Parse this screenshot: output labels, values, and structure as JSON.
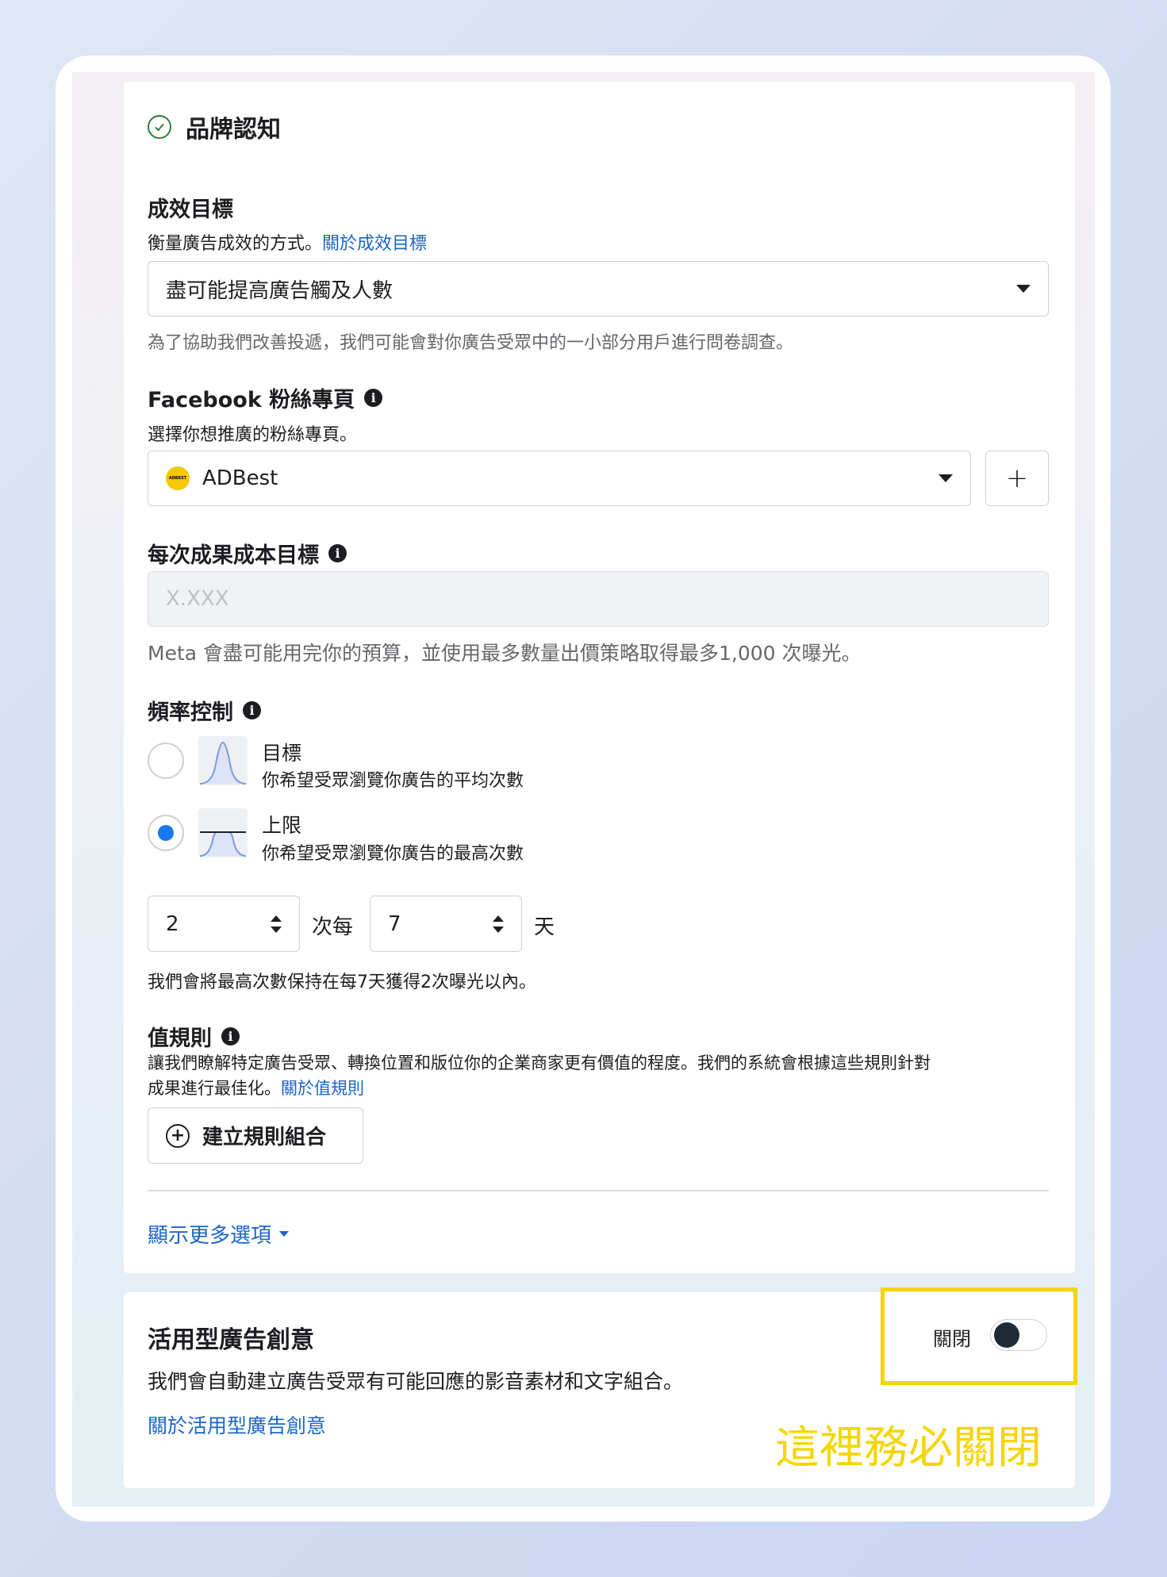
{
  "objective": {
    "title": "品牌認知"
  },
  "performance_goal": {
    "label": "成效目標",
    "desc": "衡量廣告成效的方式。",
    "link": "關於成效目標",
    "selected": "盡可能提高廣告觸及人數",
    "hint": "為了協助我們改善投遞，我們可能會對你廣告受眾中的一小部分用戶進行問卷調查。"
  },
  "facebook_page": {
    "label": "Facebook 粉絲專頁",
    "desc": "選擇你想推廣的粉絲專頁。",
    "selected": "ADBest",
    "logo_text": "ADBEST",
    "add_label": "+"
  },
  "cost_goal": {
    "label": "每次成果成本目標",
    "placeholder": "X.XXX",
    "hint": "Meta 會盡可能用完你的預算，並使用最多數量出價策略取得最多1,000 次曝光。"
  },
  "frequency": {
    "label": "頻率控制",
    "options": [
      {
        "title": "目標",
        "desc": "你希望受眾瀏覽你廣告的平均次數",
        "selected": false
      },
      {
        "title": "上限",
        "desc": "你希望受眾瀏覽你廣告的最高次數",
        "selected": true
      }
    ],
    "times_value": "2",
    "times_label": "次每",
    "days_value": "7",
    "days_label": "天",
    "summary": "我們會將最高次數保持在每7天獲得2次曝光以內。"
  },
  "value_rules": {
    "label": "值規則",
    "desc_line1": "讓我們瞭解特定廣告受眾、轉換位置和版位你的企業商家更有價值的程度。我們的系統會根據這些規則針對",
    "desc_line2": "成果進行最佳化。",
    "link": "關於值規則",
    "button": "建立規則組合"
  },
  "show_more": "顯示更多選項",
  "dynamic_creative": {
    "title": "活用型廣告創意",
    "desc": "我們會自動建立廣告受眾有可能回應的影音素材和文字組合。",
    "link": "關於活用型廣告創意",
    "toggle_label": "關閉",
    "toggle_on": false
  },
  "annotation": "這裡務必關閉",
  "colors": {
    "link": "#1a66c7",
    "highlight": "#f5d500",
    "radio_selected": "#1877f2"
  }
}
